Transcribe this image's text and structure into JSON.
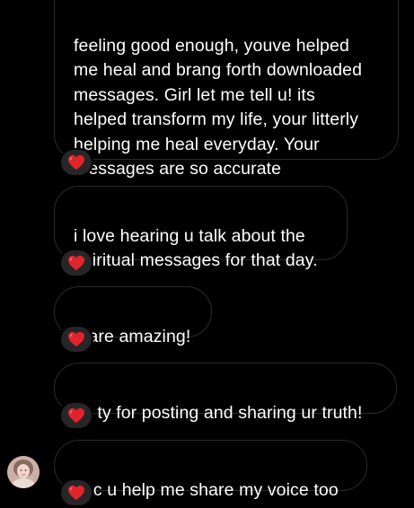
{
  "messages": [
    {
      "text": "feeling good enough, youve helped\nme heal and brang forth downloaded\nmessages. Girl let me tell u!  its\nhelped transform my life, your litterly\nhelping me heal everyday. Your\nmessages are so accurate",
      "reaction": "red-heart"
    },
    {
      "text": "i love hearing u talk about the\nspiritual messages for that day.",
      "reaction": "red-heart"
    },
    {
      "text": "u are amazing!",
      "reaction": "red-heart"
    },
    {
      "text": "so ty for posting and sharing ur truth!",
      "reaction": "red-heart"
    },
    {
      "text": "bec u help me share my voice too",
      "reaction": "red-heart"
    }
  ],
  "colors": {
    "background": "#000000",
    "bubble_border": "#2c2c2e",
    "reaction_pill": "#262628",
    "heart": "#e0242b",
    "text": "#ffffff"
  }
}
